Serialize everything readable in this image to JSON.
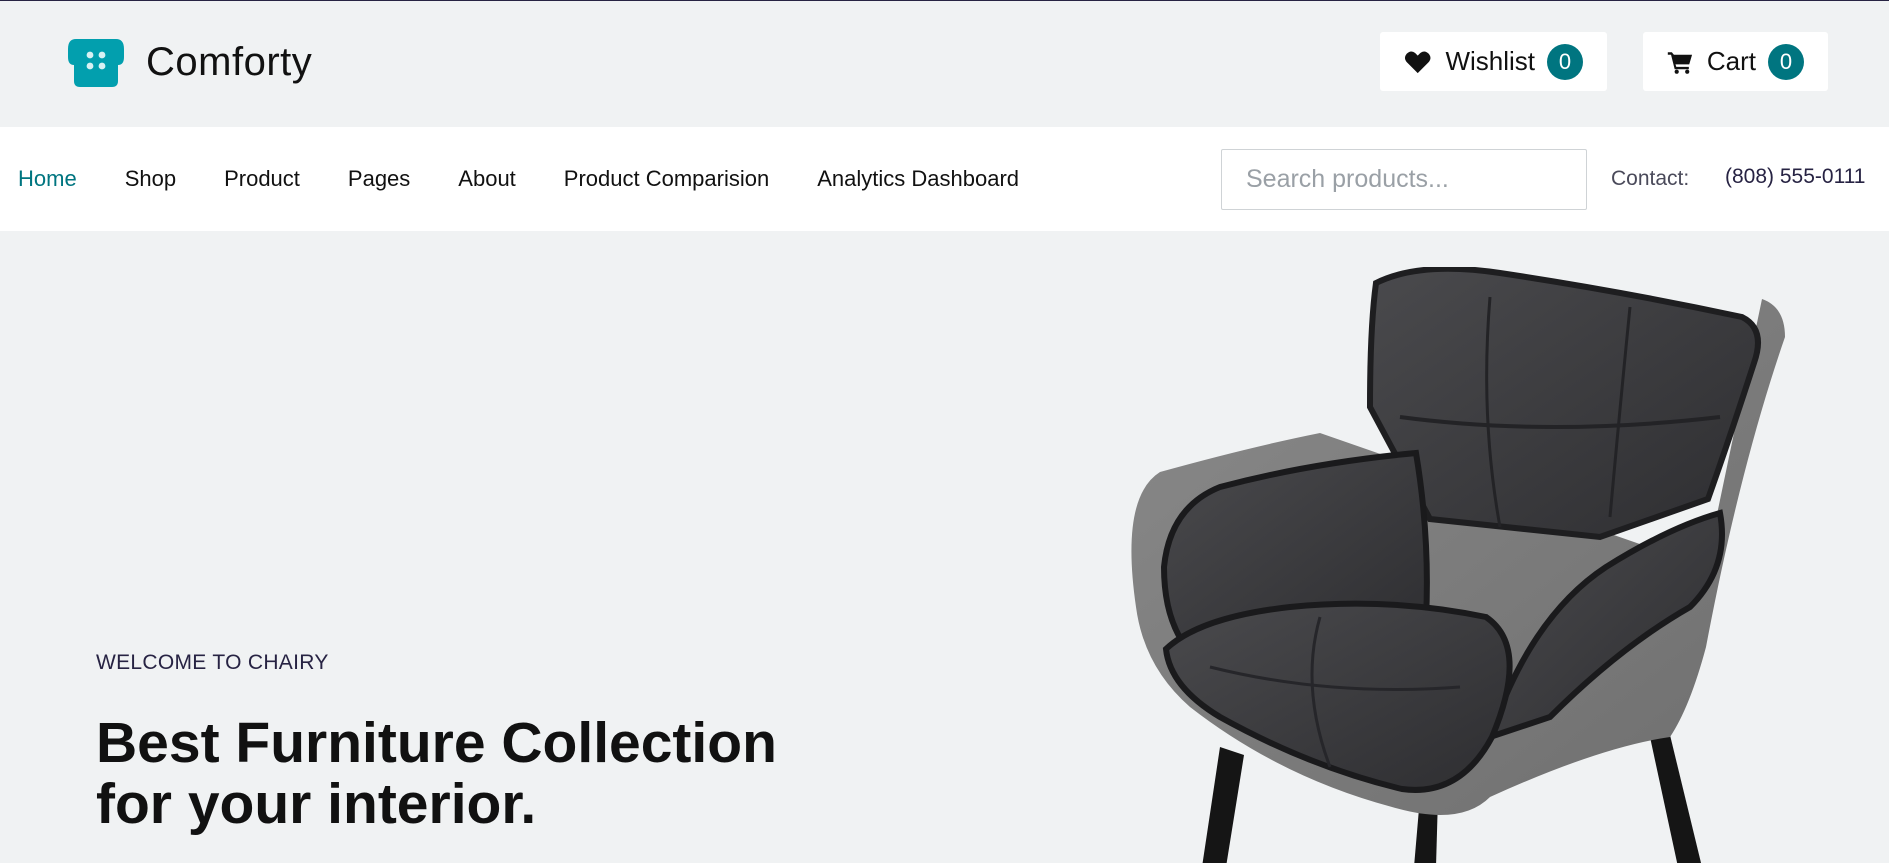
{
  "header": {
    "brand_name": "Comforty",
    "wishlist": {
      "label": "Wishlist",
      "count": "0",
      "icon": "heart-icon"
    },
    "cart": {
      "label": "Cart",
      "count": "0",
      "icon": "cart-icon"
    }
  },
  "nav": {
    "items": [
      {
        "label": "Home",
        "active": true
      },
      {
        "label": "Shop"
      },
      {
        "label": "Product"
      },
      {
        "label": "Pages"
      },
      {
        "label": "About"
      },
      {
        "label": "Product Comparision"
      },
      {
        "label": "Analytics Dashboard"
      }
    ],
    "search": {
      "placeholder": "Search products...",
      "value": ""
    },
    "contact_label": "Contact:",
    "contact_phone": "(808) 555-0111"
  },
  "hero": {
    "eyebrow": "WELCOME TO CHAIRY",
    "title": "Best Furniture Collection for your interior."
  },
  "colors": {
    "accent": "#007580",
    "logo": "#029fae",
    "page_background": "#f0f2f3",
    "text_dark": "#272343"
  }
}
